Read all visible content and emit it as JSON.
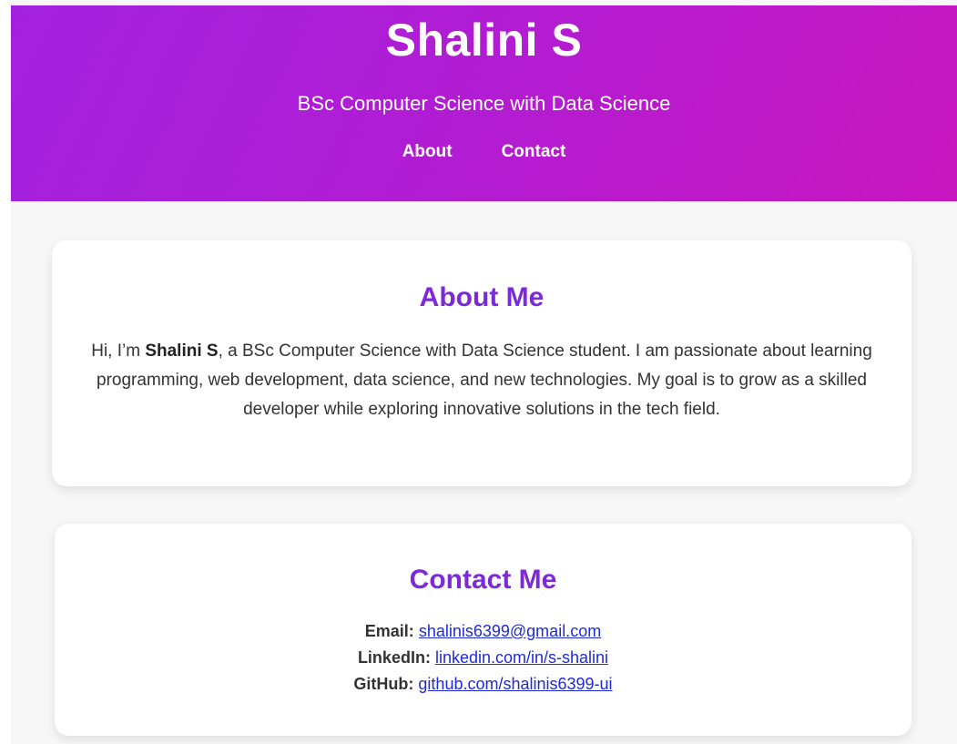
{
  "header": {
    "name": "Shalini S",
    "subtitle": "BSc Computer Science with Data Science",
    "nav": [
      {
        "label": "About"
      },
      {
        "label": "Contact"
      }
    ]
  },
  "about": {
    "title": "About Me",
    "intro": "Hi, I’m ",
    "name": "Shalini S",
    "body": ", a BSc Computer Science with Data Science student. I am passionate about learning programming, web development, data science, and new technologies. My goal is to grow as a skilled developer while exploring innovative solutions in the tech field."
  },
  "contact": {
    "title": "Contact Me",
    "items": [
      {
        "label": "Email:",
        "value": "shalinis6399@gmail.com"
      },
      {
        "label": "LinkedIn:",
        "value": "linkedin.com/in/s-shalini"
      },
      {
        "label": "GitHub:",
        "value": "github.com/shalinis6399-ui"
      }
    ]
  },
  "colors": {
    "header_gradient_start": "#a221e0",
    "header_gradient_end": "#c916bf",
    "heading_purple": "#7b2ad6",
    "link_blue": "#1f2bd6",
    "page_background": "#f7f7f7"
  }
}
